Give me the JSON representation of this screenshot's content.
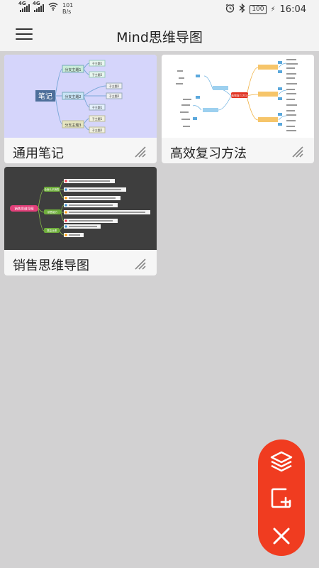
{
  "status_bar": {
    "signal1_label": "4G",
    "signal2_label": "4G",
    "net_speed": "101",
    "net_speed_unit": "B/s",
    "battery": "100",
    "time": "16:04"
  },
  "header": {
    "title": "Mind思维导图"
  },
  "cards": [
    {
      "label": "通用笔记",
      "thumb": {
        "center": "笔记",
        "branches": [
          "分支主题1",
          "分支主题2",
          "分支主题3"
        ],
        "leaves": [
          "子主题1",
          "子主题2",
          "子主题1",
          "子主题2",
          "子主题1",
          "子主题1",
          "子主题2"
        ]
      }
    },
    {
      "label": "高效复习方法",
      "thumb": {
        "center": "高效复习方法"
      }
    },
    {
      "label": "销售思维导图",
      "thumb": {
        "center": "销售思维导图",
        "branches": [
          "全面认识销售",
          "销售能力",
          "提高业绩"
        ]
      }
    }
  ],
  "fab": {
    "layers_icon": "layers-icon",
    "add_icon": "add-square-icon",
    "close_icon": "close-icon"
  },
  "colors": {
    "accent": "#f03c20",
    "background": "#d2d1d2",
    "bar": "#f3f3f3"
  }
}
